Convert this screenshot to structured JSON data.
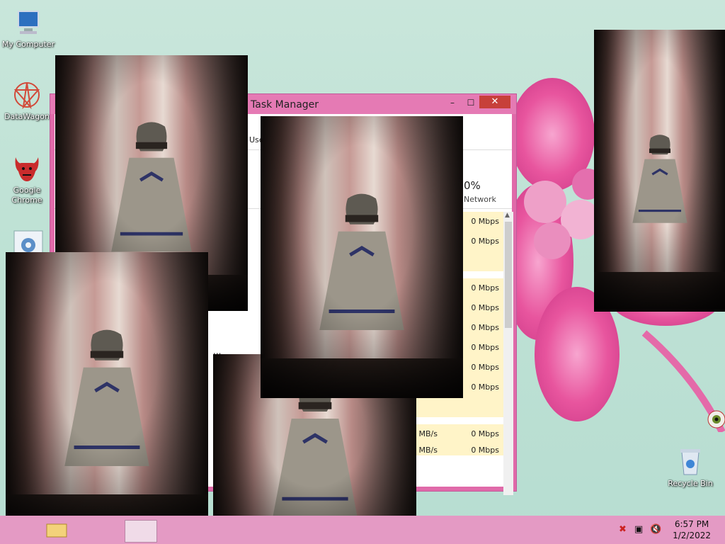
{
  "desktop": {
    "icons": [
      {
        "name": "my-computer",
        "label": "My Computer"
      },
      {
        "name": "datawagon",
        "label": "DataWagon"
      },
      {
        "name": "google-chrome",
        "label": "Google Chrome"
      },
      {
        "name": "settings",
        "label": ""
      },
      {
        "name": "recycle-bin",
        "label": "Recycle Bin"
      }
    ]
  },
  "task_manager": {
    "title": "Task Manager",
    "minimize": "–",
    "maximize": "☐",
    "close": "✕",
    "tab_users": "Use",
    "network_percent": "0%",
    "network_label": "Network",
    "ellipsis": "...",
    "rows": [
      {
        "disk": "",
        "net": "0 Mbps"
      },
      {
        "disk": "",
        "net": "0 Mbps"
      },
      {
        "disk": "",
        "net": ""
      },
      {
        "disk": "",
        "net": "0 Mbps"
      },
      {
        "disk": "",
        "net": "0 Mbps"
      },
      {
        "disk": "",
        "net": "0 Mbps"
      },
      {
        "disk": "",
        "net": "0 Mbps"
      },
      {
        "disk": "",
        "net": "0 Mbps"
      },
      {
        "disk": "",
        "net": "0 Mbps"
      },
      {
        "disk": "",
        "net": ""
      },
      {
        "disk": "0 MB/s",
        "net": "0 Mbps"
      },
      {
        "disk": "0 MB/s",
        "net": "0 Mbps"
      }
    ]
  },
  "taskbar": {
    "time": "6:57 PM",
    "date": "1/2/2022"
  },
  "colors": {
    "taskbar": "#e49ac4",
    "titlebar": "#e57ab4",
    "close": "#c7403a",
    "highlight_cell": "#fff4c8"
  }
}
